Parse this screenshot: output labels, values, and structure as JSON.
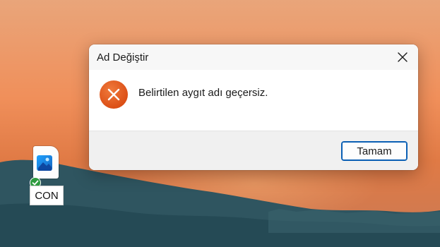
{
  "dialog": {
    "title": "Ad Değiştir",
    "message": "Belirtilen aygıt adı geçersiz.",
    "ok_label": "Tamam",
    "error_icon": "error-x-icon",
    "close_icon": "close-icon",
    "error_color": "#e2581b"
  },
  "desktop": {
    "file_label": "CON",
    "file_icon": "image-file-icon",
    "sync_icon": "check-badge-icon"
  }
}
